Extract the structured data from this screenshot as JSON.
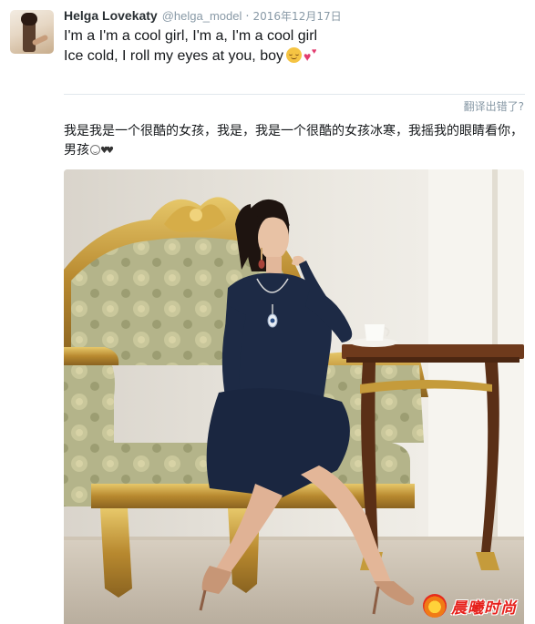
{
  "tweet": {
    "display_name": "Helga Lovekaty",
    "username": "@helga_model",
    "separator": "·",
    "timestamp": "2016年12月17日",
    "text_line1": "I'm a I'm a cool girl, I'm a, I'm a cool girl",
    "text_line2": "Ice cold, I roll my eyes at you, boy",
    "emojis": [
      "relieved-face",
      "two-hearts"
    ]
  },
  "translation": {
    "link_label": "翻译出错了?",
    "text": "我是我是一个很酷的女孩，我是，我是一个很酷的女孩冰寒，我摇我的眼睛看你，男孩",
    "emoji_hearts": "♥♥"
  },
  "colors": {
    "name": "#292f33",
    "muted": "#8899a6",
    "divider": "#e1e8ed",
    "watermark": "#e6211c",
    "dress": "#1d2a45"
  },
  "watermark": {
    "text": "晨曦时尚"
  }
}
